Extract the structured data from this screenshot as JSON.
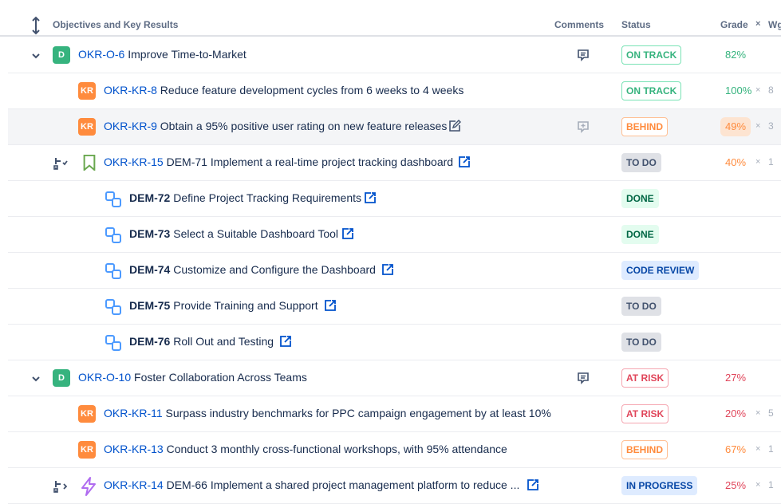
{
  "header": {
    "okr_label": "Objectives and Key Results",
    "comments_label": "Comments",
    "status_label": "Status",
    "grade_label": "Grade",
    "remove_symbol": "×",
    "weight_label": "Wg"
  },
  "rows": [
    {
      "key": "OKR-O-6",
      "title": "Improve Time-to-Market",
      "badge": "D",
      "status": "ON TRACK",
      "grade": "82%",
      "weight": ""
    },
    {
      "key": "OKR-KR-8",
      "title": "Reduce feature development cycles from 6 weeks to 4 weeks",
      "badge": "KR",
      "status": "ON TRACK",
      "grade": "100%",
      "weight": "8"
    },
    {
      "key": "OKR-KR-9",
      "title": "Obtain a 95% positive user rating on new feature releases",
      "badge": "KR",
      "status": "BEHIND",
      "grade": "49%",
      "weight": "3"
    },
    {
      "key": "OKR-KR-15",
      "title": "DEM-71 Implement a real-time project tracking dashboard",
      "status": "TO DO",
      "grade": "40%",
      "weight": "1"
    },
    {
      "key": "DEM-72",
      "title": "Define Project Tracking Requirements",
      "status": "DONE"
    },
    {
      "key": "DEM-73",
      "title": "Select a Suitable Dashboard Tool",
      "status": "DONE"
    },
    {
      "key": "DEM-74",
      "title": "Customize and Configure the Dashboard",
      "status": "CODE REVIEW"
    },
    {
      "key": "DEM-75",
      "title": "Provide Training and Support",
      "status": "TO DO"
    },
    {
      "key": "DEM-76",
      "title": "Roll Out and Testing",
      "status": "TO DO"
    },
    {
      "key": "OKR-O-10",
      "title": "Foster Collaboration Across Teams",
      "badge": "D",
      "status": "AT RISK",
      "grade": "27%",
      "weight": ""
    },
    {
      "key": "OKR-KR-11",
      "title": "Surpass industry benchmarks for PPC campaign engagement by at least 10%",
      "badge": "KR",
      "status": "AT RISK",
      "grade": "20%",
      "weight": "5"
    },
    {
      "key": "OKR-KR-13",
      "title": "Conduct 3 monthly cross-functional workshops, with 95% attendance",
      "badge": "KR",
      "status": "BEHIND",
      "grade": "67%",
      "weight": "1"
    },
    {
      "key": "OKR-KR-14",
      "title": "DEM-66 Implement a shared project management platform to reduce ...",
      "status": "IN PROGRESS",
      "grade": "25%",
      "weight": "1"
    }
  ],
  "colors": {
    "on_track": "#36b37e",
    "behind": "#ff8b3d",
    "at_risk": "#e0455a",
    "link": "#0052cc",
    "objective_badge": "#36b37e",
    "kr_badge": "#ff8b3d"
  }
}
